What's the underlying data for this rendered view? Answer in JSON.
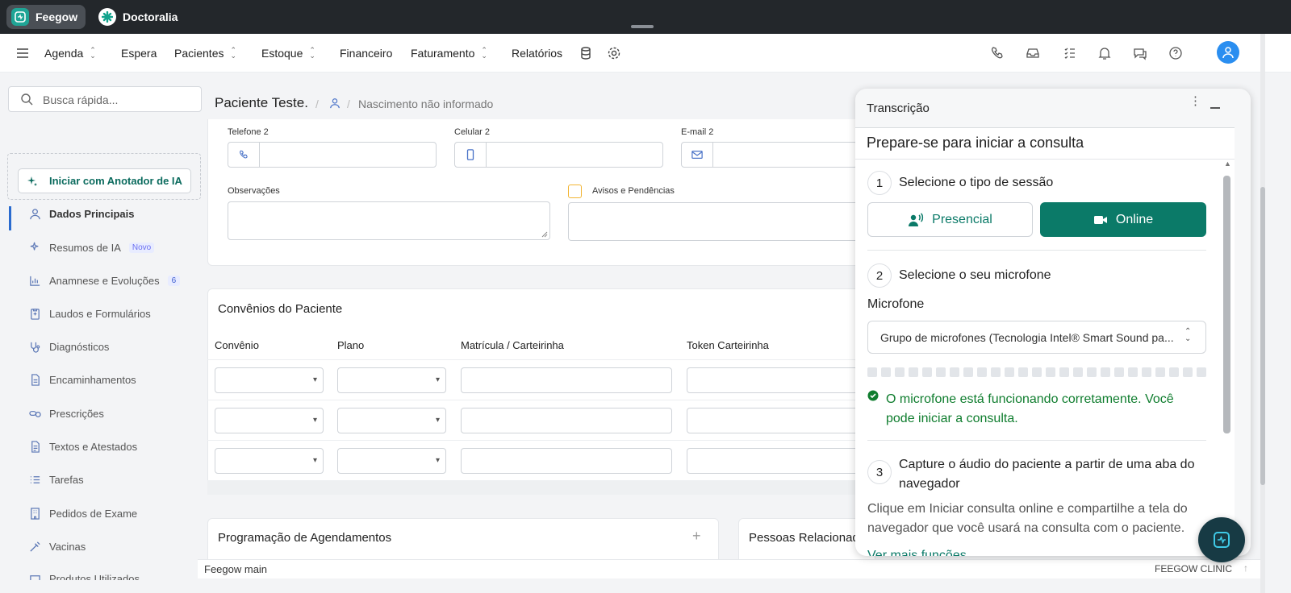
{
  "topbar": {
    "tabs": [
      {
        "label": "Feegow"
      },
      {
        "label": "Doctoralia"
      }
    ]
  },
  "nav": {
    "items": [
      {
        "label": "Agenda",
        "has_chevron": true
      },
      {
        "label": "Espera",
        "has_chevron": false
      },
      {
        "label": "Pacientes",
        "has_chevron": true
      },
      {
        "label": "Estoque",
        "has_chevron": true
      },
      {
        "label": "Financeiro",
        "has_chevron": false
      },
      {
        "label": "Faturamento",
        "has_chevron": true
      },
      {
        "label": "Relatórios",
        "has_chevron": false
      }
    ],
    "right_icons": [
      "phone-icon",
      "inbox-icon",
      "task-list-icon",
      "bell-icon",
      "chat-icon",
      "help-icon",
      "user-avatar-icon"
    ]
  },
  "sidebar": {
    "search_placeholder": "Busca rápida...",
    "ai_button": "Iniciar com Anotador de IA",
    "items": [
      {
        "label": "Dados Principais",
        "icon": "user-icon",
        "active": true
      },
      {
        "label": "Resumos de IA",
        "icon": "sparkle-icon",
        "badge": "Novo"
      },
      {
        "label": "Anamnese e Evoluções",
        "icon": "chart-icon",
        "count": "6"
      },
      {
        "label": "Laudos e Formulários",
        "icon": "clipboard-icon"
      },
      {
        "label": "Diagnósticos",
        "icon": "stethoscope-icon"
      },
      {
        "label": "Encaminhamentos",
        "icon": "document-icon"
      },
      {
        "label": "Prescrições",
        "icon": "pills-icon"
      },
      {
        "label": "Textos e Atestados",
        "icon": "file-text-icon"
      },
      {
        "label": "Tarefas",
        "icon": "list-icon"
      },
      {
        "label": "Pedidos de Exame",
        "icon": "building-icon"
      },
      {
        "label": "Vacinas",
        "icon": "syringe-icon"
      },
      {
        "label": "Produtos Utilizados",
        "icon": "box-icon"
      }
    ]
  },
  "patient": {
    "name": "Paciente Teste.",
    "separator": "/",
    "birth": "Nascimento não informado"
  },
  "form": {
    "telefone2": "Telefone 2",
    "celular2": "Celular 2",
    "email2": "E-mail 2",
    "observacoes": "Observações",
    "avisos": "Avisos e Pendências"
  },
  "convenios": {
    "title": "Convênios do Paciente",
    "headers": [
      "Convênio",
      "Plano",
      "Matrícula / Carteirinha",
      "Token Carteirinha"
    ]
  },
  "bottom_cards": {
    "programacao": "Programação de Agendamentos",
    "pessoas": "Pessoas Relacionadas"
  },
  "statusbar": {
    "left": "Feegow main",
    "right": "FEEGOW CLINIC"
  },
  "transcricao": {
    "title": "Transcrição",
    "heading": "Prepare-se para iniciar a consulta",
    "step1": {
      "number": "1",
      "title": "Selecione o tipo de sessão",
      "presencial": "Presencial",
      "online": "Online",
      "selected": "Online"
    },
    "step2": {
      "number": "2",
      "title": "Selecione o seu microfone",
      "mic_label": "Microfone",
      "mic_value": "Grupo de microfones (Tecnologia Intel® Smart Sound pa...",
      "status": "O microfone está funcionando corretamente. Você pode iniciar a consulta."
    },
    "step3": {
      "number": "3",
      "title": "Capture o áudio do paciente a partir de uma aba do navegador",
      "description": "Clique em Iniciar consulta online e compartilhe a tela do navegador que você usará na consulta com o paciente.",
      "link": "Ver mais funções"
    }
  },
  "colors": {
    "brand_green": "#0b7a68",
    "topbar": "#23272b",
    "accent_blue": "#2a7be4",
    "success_green": "#0f7d2e"
  }
}
